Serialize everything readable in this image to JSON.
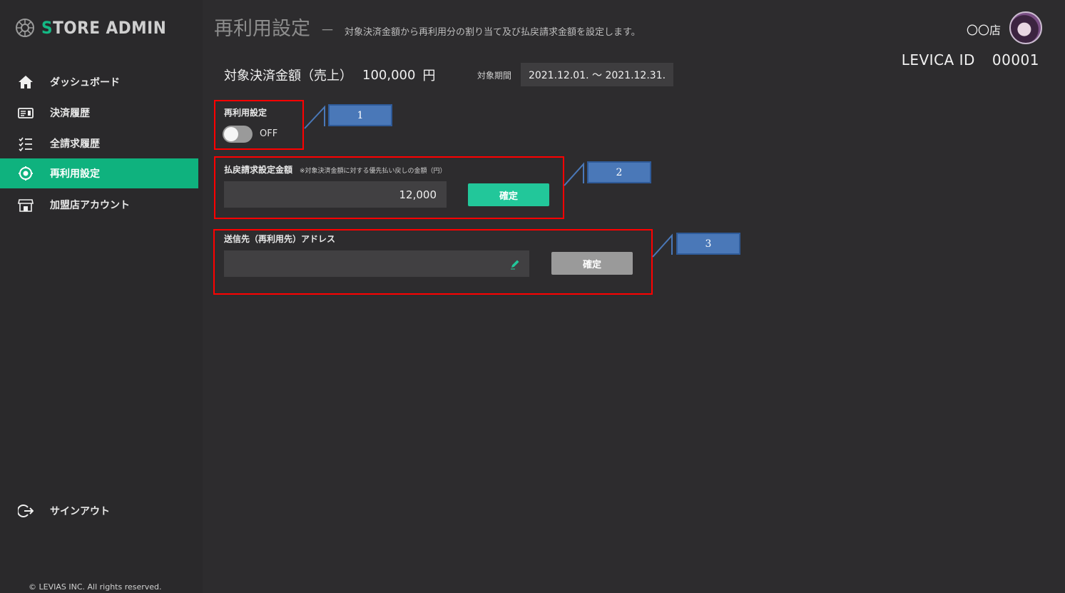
{
  "app": {
    "logo_text": "TORE ADMIN",
    "logo_initial": "S"
  },
  "sidebar": {
    "items": [
      {
        "label": "ダッシュボード",
        "icon": "home-icon"
      },
      {
        "label": "決済履歴",
        "icon": "receipt-icon"
      },
      {
        "label": "全請求履歴",
        "icon": "checklist-icon"
      },
      {
        "label": "再利用設定",
        "icon": "recycle-target-icon",
        "active": true
      },
      {
        "label": "加盟店アカウント",
        "icon": "store-icon"
      }
    ],
    "signout": "サインアウト",
    "copyright": "© LEVIAS INC. All rights reserved."
  },
  "header": {
    "title": "再利用設定",
    "dash": "－",
    "description": "対象決済金額から再利用分の割り当て及び払戻請求金額を設定します。",
    "store": "〇〇店",
    "levica_label": "LEVICA ID",
    "levica_id": "00001"
  },
  "summary": {
    "label": "対象決済金額（売上）",
    "value": "100,000",
    "unit": "円",
    "period_label": "対象期間",
    "period": "2021.12.01. ～ 2021.12.31."
  },
  "reuse": {
    "label": "再利用設定",
    "toggle_state": "OFF"
  },
  "refund": {
    "label": "払戻請求設定金額",
    "note": "※対象決済金額に対する優先払い戻しの金額（円）",
    "value": "12,000",
    "button": "確定"
  },
  "address": {
    "label": "送信先（再利用先）アドレス",
    "value": "",
    "button": "確定"
  },
  "annotations": [
    "1",
    "2",
    "3"
  ],
  "colors": {
    "accent": "#0fb27e",
    "button_green": "#22c79a",
    "highlight": "#ff0000",
    "callout": "#4a78b8"
  }
}
